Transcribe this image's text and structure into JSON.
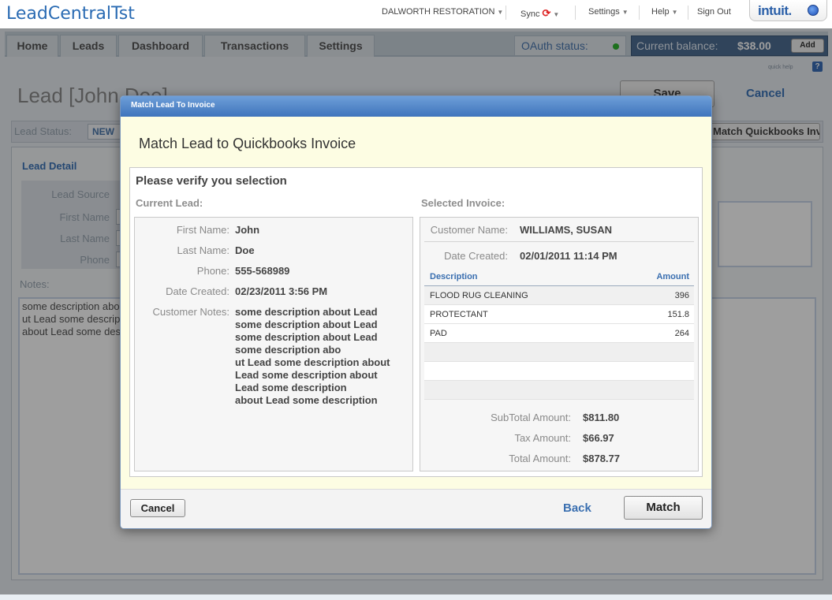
{
  "app": {
    "title": "LeadCentralTst"
  },
  "topnav": {
    "company": "DALWORTH RESTORATION",
    "sync": "Sync",
    "settings": "Settings",
    "help": "Help",
    "sign_out": "Sign Out",
    "brand": "intuit."
  },
  "tabs": [
    "Home",
    "Leads",
    "Dashboard",
    "Transactions",
    "Settings"
  ],
  "oauth": {
    "label": "OAuth status:",
    "status_color": "#2fb52f"
  },
  "balance": {
    "label": "Current balance:",
    "amount": "$38.00",
    "add": "Add"
  },
  "quick_help": "quick help",
  "lead_page": {
    "title": "Lead [John Doe]",
    "save": "Save",
    "cancel": "Cancel",
    "status_label": "Lead Status:",
    "status_value": "NEW",
    "qb_button": "Match Quickbooks Invoice",
    "detail_title": "Lead Detail",
    "fields": [
      "Lead Source",
      "First Name",
      "Last Name",
      "Phone"
    ],
    "notes_label": "Notes:",
    "notes_text": "some description abo\nut Lead some descrip\nabout Lead some des"
  },
  "modal": {
    "window_title": "Match Lead To Invoice",
    "heading": "Match Lead to Quickbooks Invoice",
    "verify_title": "Please verify you selection",
    "current_lead_label": "Current Lead:",
    "selected_invoice_label": "Selected Invoice:",
    "lead": {
      "first_name_label": "First Name:",
      "first_name": "John",
      "last_name_label": "Last Name:",
      "last_name": "Doe",
      "phone_label": "Phone:",
      "phone": "555-568989",
      "date_label": "Date Created:",
      "date": "02/23/2011 3:56 PM",
      "notes_label": "Customer Notes:",
      "notes": "some description about Lead\nsome description about Lead\nsome description about Lead\nsome description abo\nut Lead some description about\nLead some description about\nLead some description\nabout Lead some description"
    },
    "invoice": {
      "customer_label": "Customer Name:",
      "customer": "WILLIAMS, SUSAN",
      "date_label": "Date Created:",
      "date": "02/01/2011 11:14 PM",
      "table": {
        "headers": [
          "Description",
          "Amount"
        ],
        "rows": [
          {
            "description": "FLOOD RUG CLEANING",
            "amount": "396"
          },
          {
            "description": "PROTECTANT",
            "amount": "151.8"
          },
          {
            "description": "PAD",
            "amount": "264"
          }
        ]
      },
      "subtotal_label": "SubTotal Amount:",
      "subtotal": "$811.80",
      "tax_label": "Tax Amount:",
      "tax": "$66.97",
      "total_label": "Total Amount:",
      "total": "$878.77"
    },
    "buttons": {
      "cancel": "Cancel",
      "back": "Back",
      "match": "Match"
    }
  }
}
